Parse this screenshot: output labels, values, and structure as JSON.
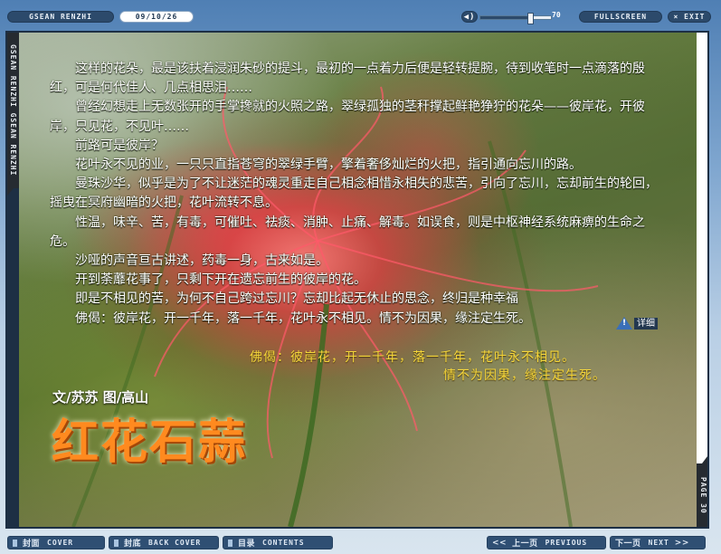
{
  "header": {
    "brand": "GSEAN RENZHI",
    "date": "09/10/26",
    "volume_icon": "speaker-icon",
    "volume_level": 70,
    "volume_label": "70",
    "fullscreen_label": "FULLSCREEN",
    "exit_label": "× EXIT"
  },
  "side_tabs": {
    "left_label": "GSEAN RENZHI GSEAN RENZHI",
    "right_label": "PAGE 30"
  },
  "article": {
    "paragraphs": [
      "这样的花朵，最是该扶着浸润朱砂的提斗，最初的一点着力后便是轻转提腕，待到收笔时一点滴落的殷红，可是何代佳人、几点相思泪……",
      "曾经幻想走上无数张开的手掌搀就的火照之路，翠绿孤独的茎秆撑起鲜艳狰狞的花朵——彼岸花，开彼岸，只见花，不见叶……",
      "前路可是彼岸？",
      "花叶永不见的业，一只只直指苍穹的翠绿手臂，擎着奢侈灿烂的火把，指引通向忘川的路。",
      "曼珠沙华，似乎是为了不让迷茫的魂灵重走自己相念相惜永相失的悲苦，引向了忘川，忘却前生的轮回，摇曳在冥府幽暗的火把，花叶流转不息。",
      "性温，味辛、苦，有毒，可催吐、祛痰、消肿、止痛、解毒。如误食，则是中枢神经系统麻痹的生命之危。",
      "沙哑的声音亘古讲述，药毒一身，古来如是。",
      "开到荼蘼花事了，只剩下开在遗忘前生的彼岸的花。",
      "即是不相见的苦，为何不自己跨过忘川？忘却比起无休止的思念，终归是种幸福",
      "佛偈：彼岸花，开一千年，落一千年，花叶永不相见。情不为因果，缘注定生死。",
      "……"
    ],
    "detail_label": "详细",
    "detail_icon": "info-triangle-icon",
    "quote_line1": "佛偈：彼岸花，开一千年，落一千年，花叶永不相见。",
    "quote_line2": "情不为因果，缘注定生死。",
    "byline": "文/苏苏  图/高山",
    "title": "红花石蒜"
  },
  "footer": {
    "cover_cn": "封面",
    "cover_en": "COVER",
    "back_cn": "封底",
    "back_en": "BACK COVER",
    "toc_cn": "目录",
    "toc_en": "CONTENTS",
    "prev_arrow": "<<",
    "prev_cn": "上一页",
    "prev_en": "PREVIOUS",
    "next_cn": "下一页",
    "next_en": "NEXT",
    "next_arrow": ">>"
  },
  "colors": {
    "bar": "#2c4a6b",
    "quote": "#f5d63a",
    "title": "#ff8a1f"
  }
}
